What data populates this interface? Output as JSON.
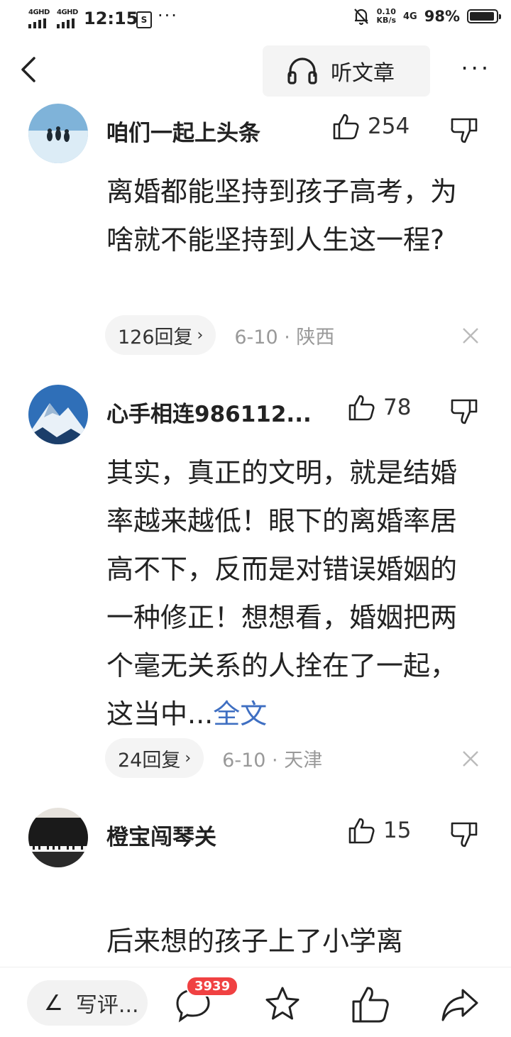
{
  "status_bar": {
    "network1": "4GHD",
    "network2": "4GHD",
    "time": "12:15",
    "sms_icon": "S",
    "more_dots": "···",
    "speed_value": "0.10",
    "speed_unit": "KB/s",
    "signal": "4G",
    "battery_percent": "98%",
    "battery_level": 0.98
  },
  "nav": {
    "back_icon": "chevron-left-icon",
    "listen_label": "听文章",
    "more_icon": "···"
  },
  "comments": [
    {
      "username": "咱们一起上头条",
      "likes": "254",
      "text": "离婚都能坚持到孩子高考，为啥就不能坚持到人生这一程?",
      "replies": "126回复",
      "date": "6-10",
      "location": "陕西",
      "avatar": "penguins-avatar"
    },
    {
      "username": "心手相连986112...",
      "likes": "78",
      "text": "其实，真正的文明，就是结婚率越来越低！眼下的离婚率居高不下，反而是对错误婚姻的一种修正！想想看，婚姻把两个毫无关系的人拴在了一起，这当中...",
      "full_text_link": "全文",
      "replies": "24回复",
      "date": "6-10",
      "location": "天津",
      "avatar": "mountain-avatar"
    },
    {
      "username": "橙宝闯琴关",
      "likes": "15",
      "text": "后来想的孩子上了小学离",
      "avatar": "piano-avatar"
    }
  ],
  "bottom_bar": {
    "write_placeholder": "写评...",
    "comment_count": "3939"
  },
  "colors": {
    "link": "#3f6fc2",
    "badge": "#f04142",
    "pill_bg": "#f4f4f4"
  }
}
